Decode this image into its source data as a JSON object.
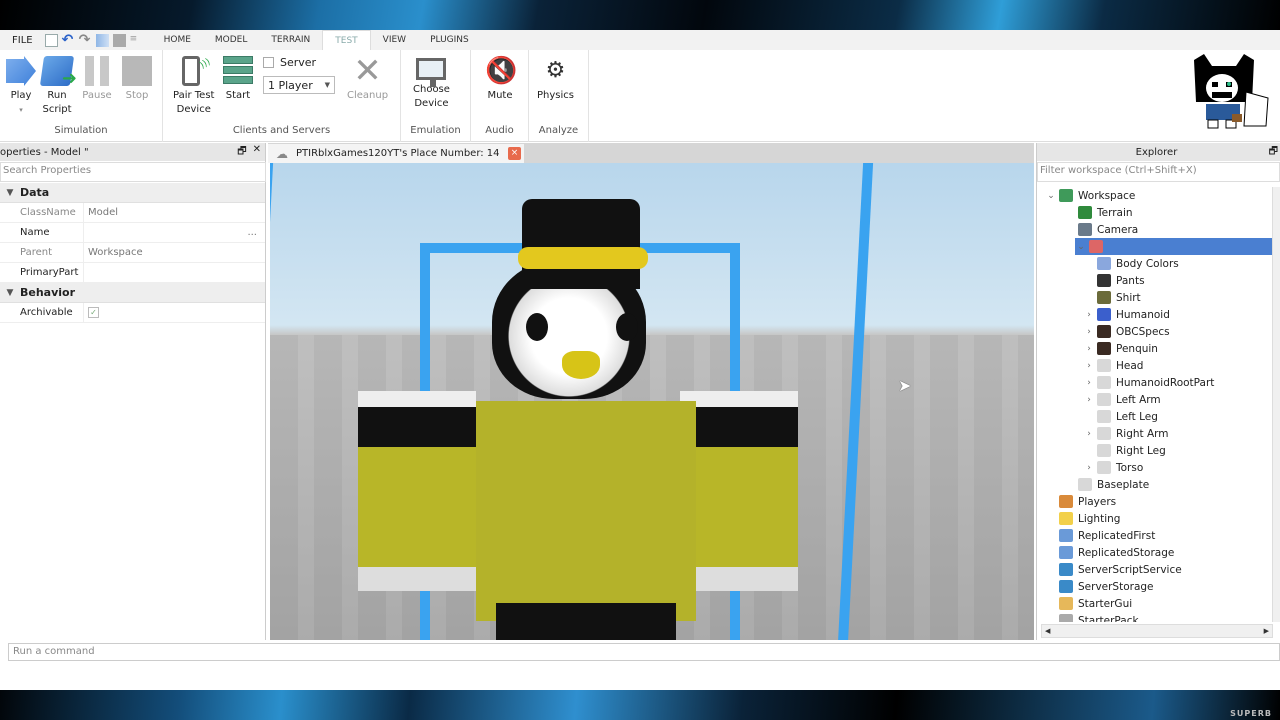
{
  "menubar": {
    "file": "FILE",
    "quick_access": [
      "new-file-icon",
      "undo-icon",
      "redo-icon",
      "play-icon",
      "stop-icon",
      "more-icon"
    ],
    "tabs": [
      "HOME",
      "MODEL",
      "TERRAIN",
      "TEST",
      "VIEW",
      "PLUGINS"
    ],
    "active_tab": "TEST"
  },
  "ribbon": {
    "simulation": {
      "label": "Simulation",
      "play": "Play",
      "run_script_1": "Run",
      "run_script_2": "Script",
      "pause": "Pause",
      "stop": "Stop"
    },
    "clients": {
      "label": "Clients and Servers",
      "pair_1": "Pair Test",
      "pair_2": "Device",
      "start": "Start",
      "server": "Server",
      "players": "1 Player",
      "cleanup": "Cleanup"
    },
    "emulation": {
      "label": "Emulation",
      "choose_1": "Choose",
      "choose_2": "Device"
    },
    "audio": {
      "label": "Audio",
      "mute": "Mute"
    },
    "analyze": {
      "label": "Analyze",
      "physics": "Physics"
    }
  },
  "properties": {
    "title": "operties - Model \"",
    "search_placeholder": "Search Properties",
    "categories": [
      {
        "name": "Data",
        "rows": [
          {
            "key": "ClassName",
            "value": "Model",
            "readonly": true
          },
          {
            "key": "Name",
            "value": "",
            "extra": "..."
          },
          {
            "key": "Parent",
            "value": "Workspace",
            "readonly": true
          },
          {
            "key": "PrimaryPart",
            "value": ""
          }
        ]
      },
      {
        "name": "Behavior",
        "rows": [
          {
            "key": "Archivable",
            "checked": true
          }
        ]
      }
    ]
  },
  "viewport": {
    "tab_title": "PTIRblxGames120YT's Place Number: 14",
    "close": "×"
  },
  "explorer": {
    "title": "Explorer",
    "filter_placeholder": "Filter workspace (Ctrl+Shift+X)",
    "nodes": [
      {
        "label": "Workspace",
        "depth": 0,
        "arrow": "expanded",
        "icon": "workspace-icon",
        "color": "#3f9a5a"
      },
      {
        "label": "Terrain",
        "depth": 1,
        "arrow": "none",
        "icon": "terrain-icon",
        "color": "#2f8a3c"
      },
      {
        "label": "Camera",
        "depth": 1,
        "arrow": "none",
        "icon": "camera-icon",
        "color": "#6a7a8a"
      },
      {
        "label": "",
        "depth": 1,
        "arrow": "expanded",
        "icon": "model-icon",
        "color": "#d66",
        "selected": true
      },
      {
        "label": "Body Colors",
        "depth": 2,
        "arrow": "none",
        "icon": "body-colors-icon",
        "color": "#8aa7dd"
      },
      {
        "label": "Pants",
        "depth": 2,
        "arrow": "none",
        "icon": "pants-icon",
        "color": "#333"
      },
      {
        "label": "Shirt",
        "depth": 2,
        "arrow": "none",
        "icon": "shirt-icon",
        "color": "#6b6b3a"
      },
      {
        "label": "Humanoid",
        "depth": 2,
        "arrow": "collapsed",
        "icon": "humanoid-icon",
        "color": "#3b5fcc"
      },
      {
        "label": "OBCSpecs",
        "depth": 2,
        "arrow": "collapsed",
        "icon": "accessory-icon",
        "color": "#3a2a22"
      },
      {
        "label": "Penquin",
        "depth": 2,
        "arrow": "collapsed",
        "icon": "accessory-icon",
        "color": "#3a2a22"
      },
      {
        "label": "Head",
        "depth": 2,
        "arrow": "collapsed",
        "icon": "part-icon",
        "color": "#d8d8d8"
      },
      {
        "label": "HumanoidRootPart",
        "depth": 2,
        "arrow": "collapsed",
        "icon": "part-icon",
        "color": "#d8d8d8"
      },
      {
        "label": "Left Arm",
        "depth": 2,
        "arrow": "collapsed",
        "icon": "part-icon",
        "color": "#d8d8d8"
      },
      {
        "label": "Left Leg",
        "depth": 2,
        "arrow": "none",
        "icon": "part-icon",
        "color": "#d8d8d8"
      },
      {
        "label": "Right Arm",
        "depth": 2,
        "arrow": "collapsed",
        "icon": "part-icon",
        "color": "#d8d8d8"
      },
      {
        "label": "Right Leg",
        "depth": 2,
        "arrow": "none",
        "icon": "part-icon",
        "color": "#d8d8d8"
      },
      {
        "label": "Torso",
        "depth": 2,
        "arrow": "collapsed",
        "icon": "part-icon",
        "color": "#d8d8d8"
      },
      {
        "label": "Baseplate",
        "depth": 1,
        "arrow": "none",
        "icon": "part-icon",
        "color": "#d8d8d8"
      },
      {
        "label": "Players",
        "depth": 0,
        "arrow": "none",
        "icon": "players-icon",
        "color": "#d98a3a"
      },
      {
        "label": "Lighting",
        "depth": 0,
        "arrow": "none",
        "icon": "lighting-icon",
        "color": "#f2d04a"
      },
      {
        "label": "ReplicatedFirst",
        "depth": 0,
        "arrow": "none",
        "icon": "replicated-first-icon",
        "color": "#6a9ad8"
      },
      {
        "label": "ReplicatedStorage",
        "depth": 0,
        "arrow": "none",
        "icon": "replicated-storage-icon",
        "color": "#6a9ad8"
      },
      {
        "label": "ServerScriptService",
        "depth": 0,
        "arrow": "none",
        "icon": "server-script-service-icon",
        "color": "#3a8ac8"
      },
      {
        "label": "ServerStorage",
        "depth": 0,
        "arrow": "none",
        "icon": "server-storage-icon",
        "color": "#3a8ac8"
      },
      {
        "label": "StarterGui",
        "depth": 0,
        "arrow": "none",
        "icon": "starter-gui-icon",
        "color": "#e6b85a"
      },
      {
        "label": "StarterPack",
        "depth": 0,
        "arrow": "none",
        "icon": "starter-pack-icon",
        "color": "#aaa"
      }
    ]
  },
  "command_bar": {
    "placeholder": "Run a command"
  },
  "watermark": "SUPERB"
}
